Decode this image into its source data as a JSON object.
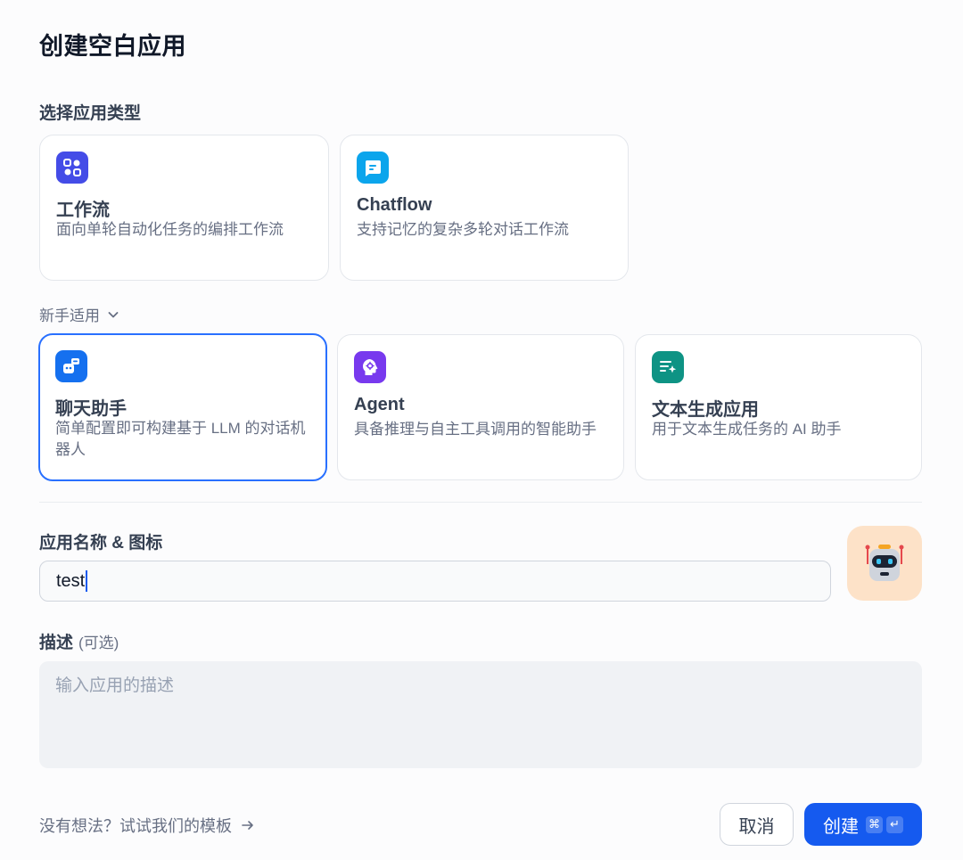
{
  "dialog": {
    "title": "创建空白应用"
  },
  "app_type": {
    "label": "选择应用类型",
    "primary": [
      {
        "name": "工作流",
        "desc": "面向单轮自动化任务的编排工作流",
        "icon": "workflow-icon",
        "color": "#444ce7"
      },
      {
        "name": "Chatflow",
        "desc": "支持记忆的复杂多轮对话工作流",
        "icon": "chatflow-icon",
        "color": "#0ba5ec"
      }
    ],
    "beginner_label": "新手适用",
    "beginner": [
      {
        "name": "聊天助手",
        "desc": "简单配置即可构建基于 LLM 的对话机器人",
        "icon": "chatbot-icon",
        "color": "#1570ef",
        "selected": true
      },
      {
        "name": "Agent",
        "desc": "具备推理与自主工具调用的智能助手",
        "icon": "agent-icon",
        "color": "#7839ee"
      },
      {
        "name": "文本生成应用",
        "desc": "用于文本生成任务的 AI 助手",
        "icon": "text-generation-icon",
        "color": "#0e9384"
      }
    ]
  },
  "name_section": {
    "label": "应用名称 & 图标",
    "value": "test",
    "icon": "robot-icon",
    "icon_bg": "#fde2c8"
  },
  "description": {
    "label": "描述",
    "optional": "(可选)",
    "placeholder": "输入应用的描述"
  },
  "footer": {
    "template_link": "没有想法？试试我们的模板",
    "cancel": "取消",
    "create": "创建",
    "shortcut_cmd": "⌘",
    "shortcut_enter": "↵"
  },
  "colors": {
    "primary": "#155aef",
    "selected_border": "#2970ff"
  }
}
